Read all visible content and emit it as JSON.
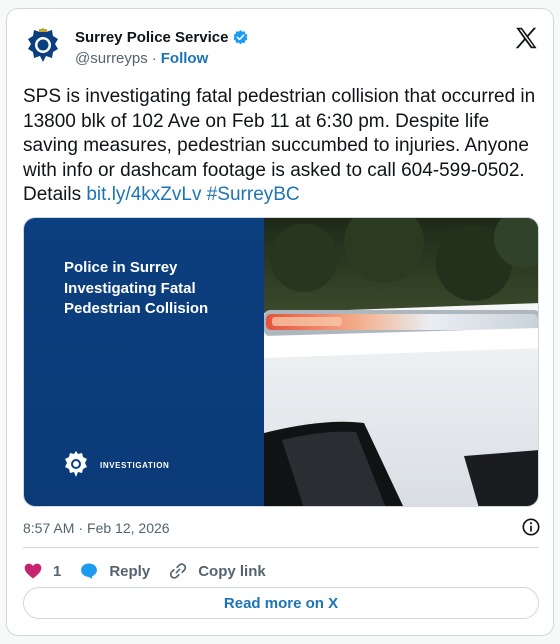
{
  "account": {
    "display_name": "Surrey Police Service",
    "handle": "@surreyps",
    "separator": "·",
    "follow_label": "Follow",
    "verified": true
  },
  "tweet": {
    "text_main": "SPS is investigating fatal pedestrian collision that occurred in 13800 blk of 102 Ave on Feb 11 at 6:30 pm. Despite life saving measures, pedestrian succumbed to injuries. Anyone with info or dashcam footage is asked to call 604-599-0502. Details ",
    "link": "bit.ly/4kxZvLv",
    "hashtag": "#SurreyBC"
  },
  "media": {
    "title": "Police in Surrey Investigating Fatal Pedestrian Collision",
    "badge_label": "INVESTIGATION"
  },
  "meta": {
    "time": "8:57 AM",
    "separator": "·",
    "date": "Feb 12, 2026"
  },
  "actions": {
    "like_count": "1",
    "reply_label": "Reply",
    "copy_label": "Copy link"
  },
  "footer": {
    "read_more_label": "Read more on X"
  },
  "colors": {
    "accent": "#1d74b6",
    "like": "#c5246e",
    "banner_blue": "#0c3f7f",
    "text": "#0f1419",
    "muted": "#536471",
    "border": "#cfd9de"
  },
  "icons": [
    "surrey-police-crest-icon",
    "verified-badge-icon",
    "x-logo-icon",
    "info-icon",
    "heart-icon",
    "reply-bubble-icon",
    "link-icon"
  ]
}
